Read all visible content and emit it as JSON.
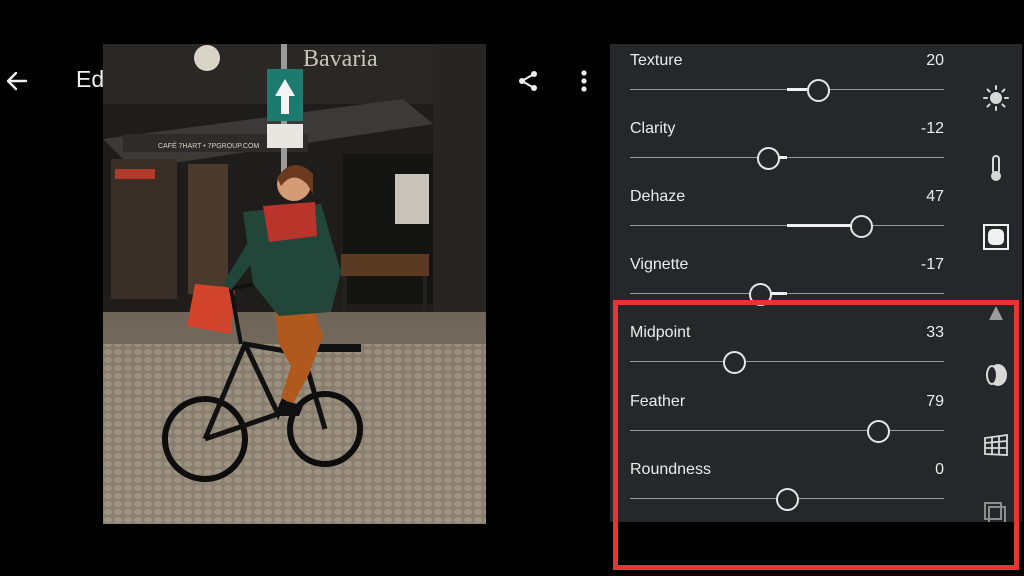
{
  "toolbar": {
    "edit_label": "Edit"
  },
  "photo": {
    "storefront_sign": "Bavaria",
    "cafe_sign": "CAFÉ 7HART • 7PGROUP.COM"
  },
  "panel": {
    "sliders": [
      {
        "label": "Texture",
        "value": "20",
        "level": 20,
        "min": -100,
        "max": 100
      },
      {
        "label": "Clarity",
        "value": "-12",
        "level": -12,
        "min": -100,
        "max": 100
      },
      {
        "label": "Dehaze",
        "value": "47",
        "level": 47,
        "min": -100,
        "max": 100
      },
      {
        "label": "Vignette",
        "value": "-17",
        "level": -17,
        "min": -100,
        "max": 100
      },
      {
        "label": "Midpoint",
        "value": "33",
        "level": 33,
        "min": 0,
        "max": 100
      },
      {
        "label": "Feather",
        "value": "79",
        "level": 79,
        "min": 0,
        "max": 100
      },
      {
        "label": "Roundness",
        "value": "0",
        "level": 0,
        "min": -100,
        "max": 100
      }
    ],
    "side_icons": [
      "light-icon",
      "color-temperature-icon",
      "effects-icon",
      "detail-icon",
      "optics-icon",
      "geometry-icon",
      "versions-icon"
    ]
  },
  "colors": {
    "panel_bg": "#26272a",
    "highlight": "#e53535",
    "slider_fill": "#f0f0f0"
  }
}
